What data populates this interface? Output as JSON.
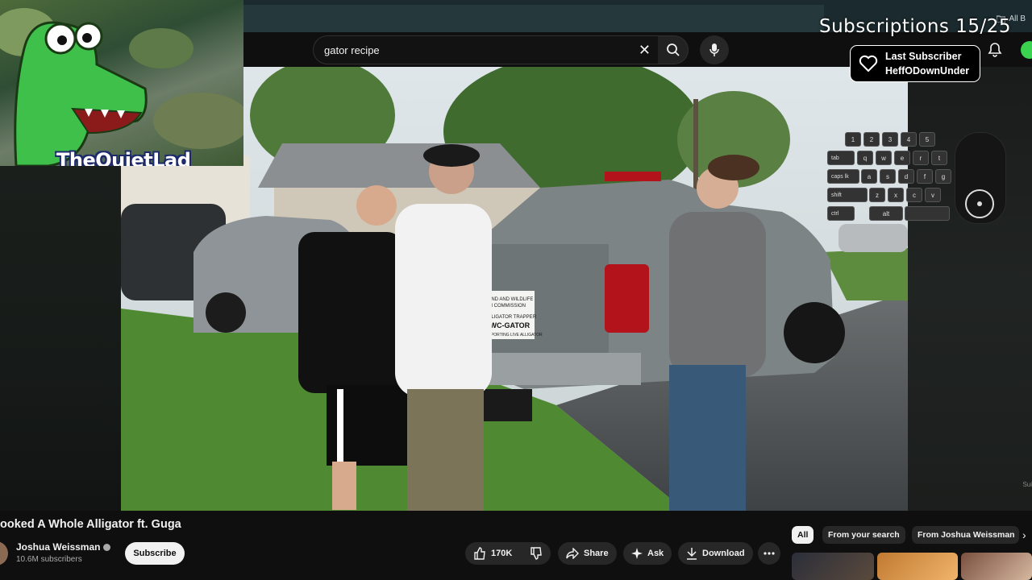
{
  "browser": {
    "bookmark_label": "All B"
  },
  "search": {
    "query": "gator recipe"
  },
  "overlay": {
    "channel_name": "TheQuietLad",
    "subs_goal": "Subscriptions 15/25",
    "last_sub_label": "Last Subscriber",
    "last_sub_name": "HeffODownUnder",
    "keyboard": {
      "numbers": [
        "1",
        "2",
        "3",
        "4",
        "5"
      ],
      "row_tab": [
        "tab",
        "q",
        "w",
        "e",
        "r",
        "t"
      ],
      "row_caps": [
        "caps lk",
        "a",
        "s",
        "d",
        "f",
        "g"
      ],
      "row_shift": [
        "shift",
        "z",
        "x",
        "c",
        "v"
      ],
      "row_ctrl": [
        "ctrl",
        "alt"
      ]
    },
    "side_text": "Sui"
  },
  "video": {
    "title": "ooked A Whole Alligator ft. Guga",
    "sign_lines": [
      "LAND AND WILDLIFE",
      "ON COMMISSION",
      "ALLIGATOR TRAPPER",
      "FWC-GATOR",
      "REPORTING LIVE ALLIGATOR"
    ]
  },
  "channel": {
    "name": "Joshua Weissman",
    "subscribers": "10.6M subscribers",
    "subscribe_label": "Subscribe"
  },
  "actions": {
    "likes": "170K",
    "share": "Share",
    "ask": "Ask",
    "download": "Download"
  },
  "chips": [
    "All",
    "From your search",
    "From Joshua Weissman"
  ],
  "colors": {
    "bg": "#0f0f0f",
    "chip_active": "#f1f1f1",
    "pill_bg": "#272727",
    "accent_green": "#3ad24f"
  }
}
